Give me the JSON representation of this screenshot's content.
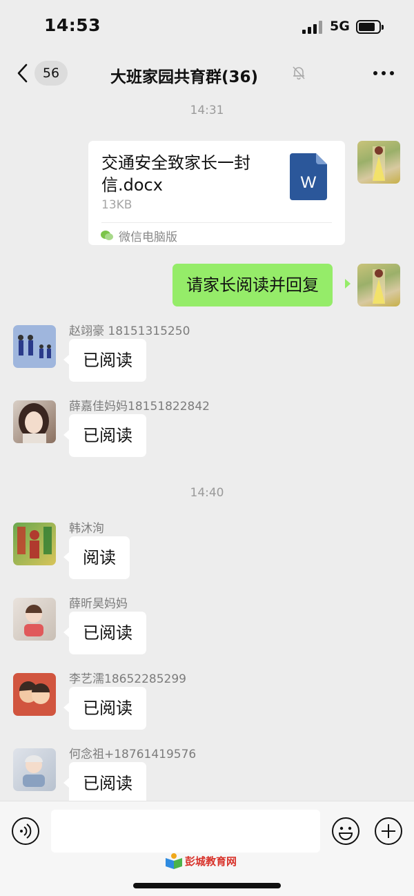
{
  "status_bar": {
    "time": "14:53",
    "network": "5G"
  },
  "nav": {
    "unread_count": "56",
    "title": "大班家园共育群(36)"
  },
  "messages": {
    "time_1": "14:31",
    "file": {
      "name": "交通安全致家长一封信.docx",
      "size": "13KB",
      "source": "微信电脑版",
      "icon_letter": "W"
    },
    "my_text": "请家长阅读并回复",
    "m1": {
      "sender": "赵翊豪 18151315250",
      "text": "已阅读"
    },
    "m2": {
      "sender": "薛嘉佳妈妈18151822842",
      "text": "已阅读"
    },
    "time_2": "14:40",
    "m3": {
      "sender": "韩沐洵",
      "text": "阅读"
    },
    "m4": {
      "sender": "薛昕昊妈妈",
      "text": "已阅读"
    },
    "m5": {
      "sender": "李艺濡18652285299",
      "text": "已阅读"
    },
    "m6": {
      "sender": "何念祖+18761419576",
      "text": "已阅读"
    }
  },
  "input_bar": {
    "placeholder": ""
  },
  "watermark": "彭城教育网",
  "colors": {
    "my_bubble": "#95ec69",
    "background": "#ededed",
    "word_icon": "#2b579a"
  }
}
